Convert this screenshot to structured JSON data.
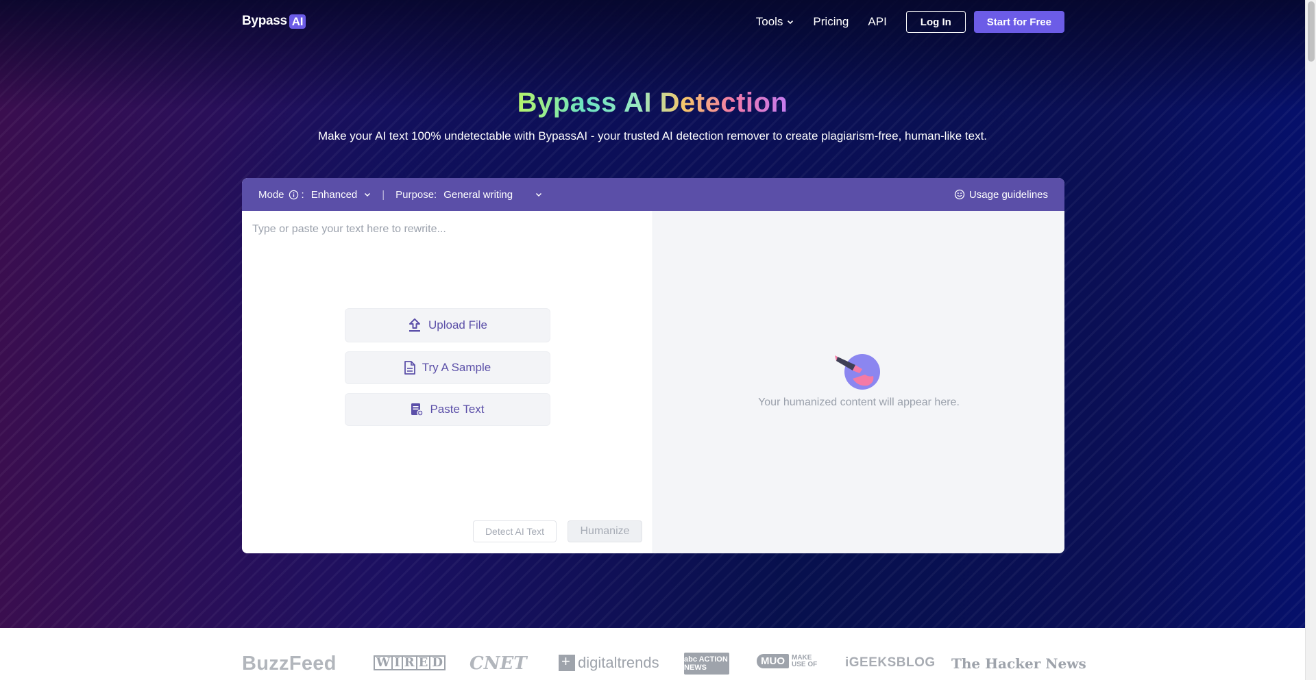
{
  "nav": {
    "logo_text": "Bypass",
    "logo_badge": "AI",
    "links": [
      "Tools",
      "Pricing",
      "API"
    ],
    "login_label": "Log In",
    "start_label": "Start for Free"
  },
  "hero": {
    "title": "Bypass AI Detection",
    "subtitle": "Make your AI text 100% undetectable with BypassAI - your trusted AI detection remover to create plagiarism-free, human-like text."
  },
  "toolbar": {
    "mode_label": "Mode",
    "mode_colon": ":",
    "mode_value": "Enhanced",
    "separator": "|",
    "purpose_label": "Purpose:",
    "purpose_value": "General writing",
    "usage_label": "Usage guidelines"
  },
  "editor": {
    "placeholder": "Type or paste your text here to rewrite...",
    "upload_label": "Upload File",
    "sample_label": "Try A Sample",
    "paste_label": "Paste Text",
    "detect_label": "Detect AI Text",
    "humanize_label": "Humanize"
  },
  "output": {
    "empty_text": "Your humanized content will appear here."
  },
  "media_logos": {
    "buzzfeed": "BuzzFeed",
    "wired": [
      "W",
      "I",
      "R",
      "E",
      "D"
    ],
    "cnet": "CNET",
    "digitaltrends": "digitaltrends",
    "abc": "abc ACTION NEWS",
    "muo": "MUO",
    "muo_sub": "MAKE USE OF",
    "igeeks": "iGEEKSBLOG",
    "hacker": "The Hacker News"
  },
  "colors": {
    "accent": "#6c5ce7",
    "toolbar_bg": "#5b4fa8",
    "muted_text": "#9aa0ab"
  }
}
